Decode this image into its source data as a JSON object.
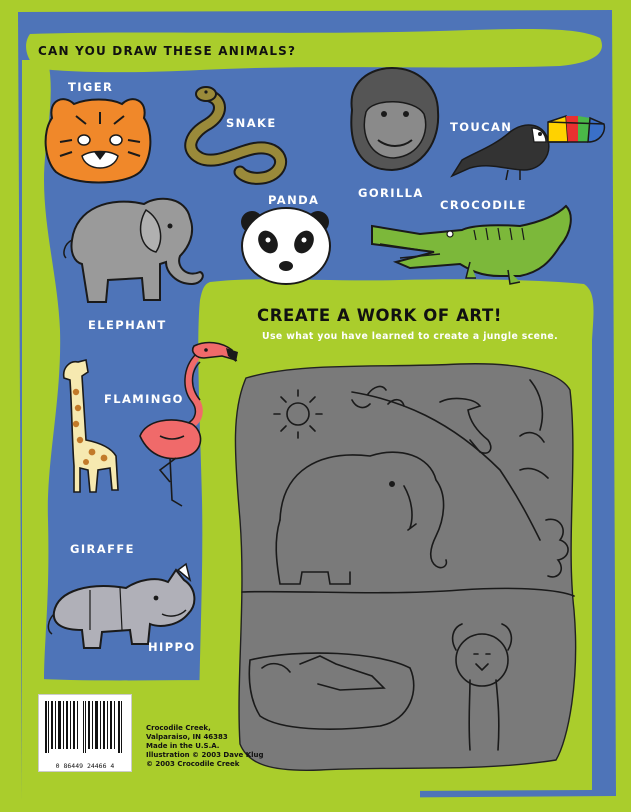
{
  "heading": "CAN YOU DRAW THESE ANIMALS?",
  "animals": {
    "tiger": "TIGER",
    "snake": "SNAKE",
    "gorilla": "GORILLA",
    "toucan": "TOUCAN",
    "panda": "PANDA",
    "crocodile": "CROCODILE",
    "elephant": "ELEPHANT",
    "flamingo": "FLAMINGO",
    "giraffe": "GIRAFFE",
    "hippo": "HIPPO"
  },
  "art": {
    "title": "CREATE A WORK OF ART!",
    "subtitle": "Use what you have learned to create a jungle scene."
  },
  "barcode": {
    "number": "0 86449 24466 4"
  },
  "publisher": {
    "lines": [
      "Crocodile Creek,",
      "Valparaiso, IN 46383",
      "Made in the U.S.A.",
      "Illustration © 2003 Dave Klug",
      "© 2003 Crocodile Creek"
    ]
  },
  "colors": {
    "green": "#aacd2c",
    "blue": "#4e74b8",
    "gray": "#7a7a7a",
    "tiger": "#f0882a",
    "flamingo": "#f06a6a",
    "elephant": "#9a9a9a"
  }
}
